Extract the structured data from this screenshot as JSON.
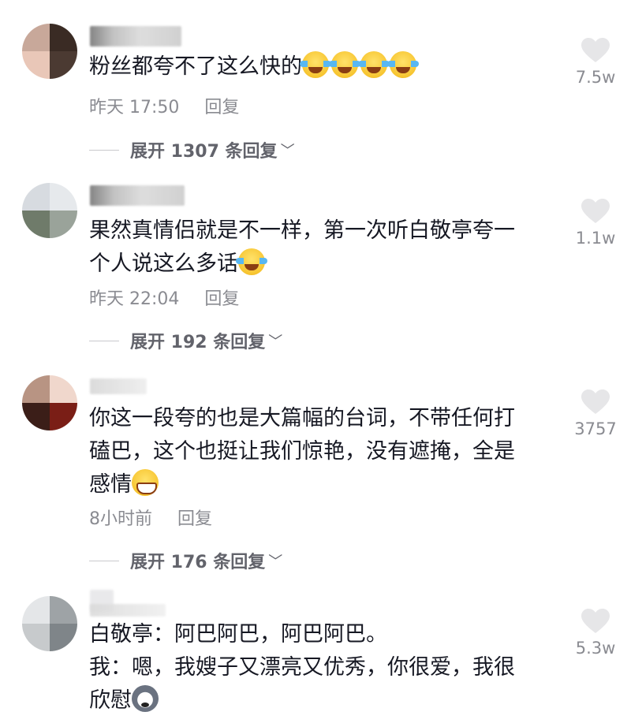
{
  "comments": [
    {
      "text_lines": [
        "粉丝都夸不了这么快的"
      ],
      "emojis_after": [
        "crying-laughing",
        "crying-laughing",
        "crying-laughing",
        "crying-laughing"
      ],
      "time": "昨天 17:50",
      "reply_label": "回复",
      "expand_label": "展开 1307 条回复",
      "likes": "7.5w"
    },
    {
      "text_lines": [
        "果然真情侣就是不一样，第一次听白敬亭夸一",
        "个人说这么多话"
      ],
      "emojis_after": [
        "rolling-laughing"
      ],
      "time": "昨天 22:04",
      "reply_label": "回复",
      "expand_label": "展开 192 条回复",
      "likes": "1.1w"
    },
    {
      "text_lines": [
        "你这一段夸的也是大篇幅的台词，不带任何打",
        "磕巴，这个也挺让我们惊艳，没有遮掩，全是",
        "感情"
      ],
      "emojis_after": [
        "grinning"
      ],
      "time": "8小时前",
      "reply_label": "回复",
      "expand_label": "展开 176 条回复",
      "likes": "3757"
    },
    {
      "text_lines": [
        "白敬亭：阿巴阿巴，阿巴阿巴。",
        "我：嗯，我嫂子又漂亮又优秀，你很爱，我很",
        "欣慰"
      ],
      "emojis_after": [
        "husky"
      ],
      "likes": "5.3w"
    }
  ],
  "colors": {
    "text": "#161823",
    "meta": "#8a8b91",
    "heart": "#e6e6e8"
  }
}
